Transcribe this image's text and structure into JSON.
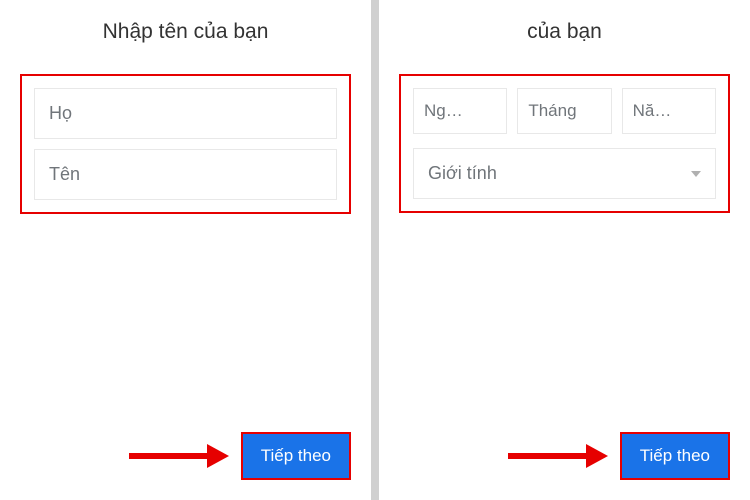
{
  "left_panel": {
    "title": "Nhập tên của bạn",
    "fields": {
      "last_name_placeholder": "Họ",
      "first_name_placeholder": "Tên"
    },
    "next_button": "Tiếp theo"
  },
  "right_panel": {
    "title_partial": "của bạn",
    "date_fields": {
      "day": "Ng…",
      "month": "Tháng",
      "year": "Nă…"
    },
    "gender_label": "Giới tính",
    "next_button": "Tiếp theo"
  },
  "colors": {
    "highlight_border": "#e60000",
    "primary_button": "#1a73e8",
    "input_border": "#e8e8e8",
    "placeholder_text": "#70757a"
  }
}
